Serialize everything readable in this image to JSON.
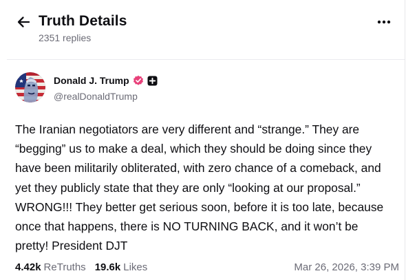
{
  "header": {
    "title": "Truth Details",
    "subtitle": "2351 replies",
    "back_icon": "arrow-left-icon",
    "more_icon": "more-horizontal-icon"
  },
  "post": {
    "author": {
      "display_name": "Donald J. Trump",
      "handle": "@realDonaldTrump",
      "verified_badge_icon": "verified-badge-icon",
      "verified_color": "#e8417a",
      "extra_badge_icon": "plus-badge-icon"
    },
    "body": "The Iranian negotiators are very different and “strange.” They are “begging” us to make a deal, which they should be doing since they have been militarily obliterated, with zero chance of a comeback, and yet they publicly state that they are only “looking at our proposal.” WRONG!!! They better get serious soon, before it is too late, because once that happens, there is NO TURNING BACK, and it won’t be pretty! President DJT",
    "stats": {
      "retruths_count": "4.42k",
      "retruths_label": "ReTruths",
      "likes_count": "19.6k",
      "likes_label": "Likes"
    },
    "timestamp": "Mar 26, 2026, 3:39 PM"
  }
}
